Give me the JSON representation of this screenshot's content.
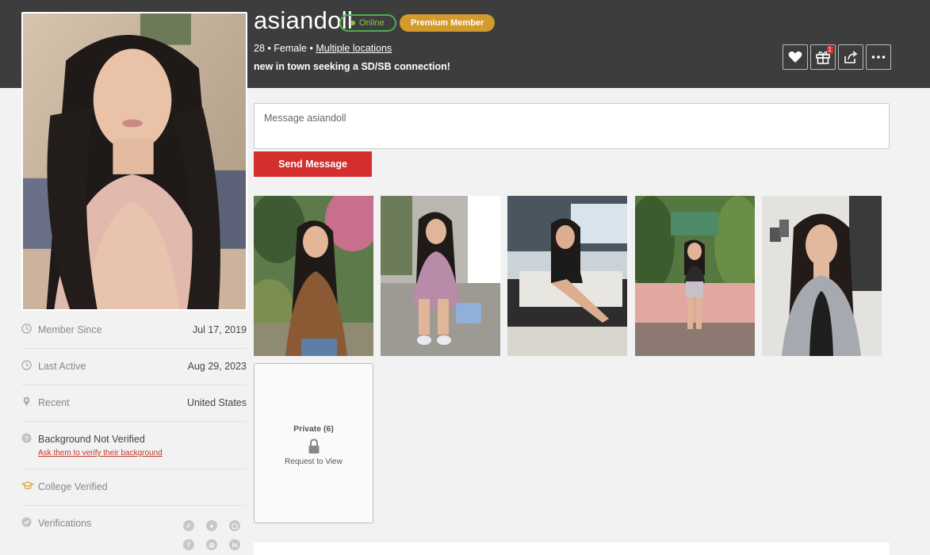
{
  "profile": {
    "username": "asiandoll",
    "online_label": "Online",
    "premium_label": "Premium Member",
    "age": "28",
    "gender": "Female",
    "location": "Multiple locations",
    "separator": "•",
    "headline": "new in town seeking a SD/SB connection!"
  },
  "actions": {
    "favorite_icon": "heart-icon",
    "gift_icon": "gift-icon",
    "gift_count": "1",
    "share_icon": "share-icon",
    "more_icon": "more-icon"
  },
  "message": {
    "placeholder": "Message asiandoll",
    "send_label": "Send Message"
  },
  "photos": {
    "public_count": 5,
    "private_label": "Private (6)",
    "request_label": "Request to View"
  },
  "details": {
    "member_since_label": "Member Since",
    "member_since_value": "Jul 17, 2019",
    "last_active_label": "Last Active",
    "last_active_value": "Aug 29, 2023",
    "recent_label": "Recent",
    "recent_value": "United States",
    "background_title": "Background Not Verified",
    "background_link": "Ask them to verify their background",
    "college_label": "College Verified",
    "verifications_label": "Verifications"
  },
  "colors": {
    "header_bg": "#3d3d3d",
    "accent_red": "#d32f2f",
    "online_green": "#8bc34a",
    "premium_gold": "#d39a2c"
  }
}
